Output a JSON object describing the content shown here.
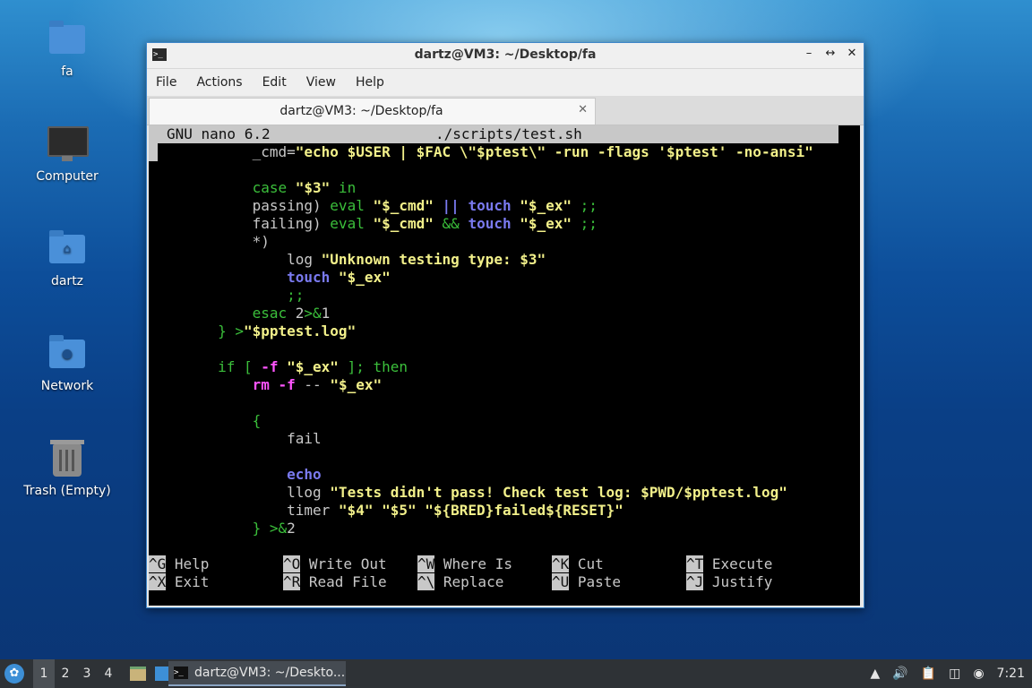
{
  "desktop": {
    "icons": [
      {
        "label": "fa",
        "icon": "folder-icon"
      },
      {
        "label": "Computer",
        "icon": "computer-icon"
      },
      {
        "label": "dartz",
        "icon": "home-folder-icon"
      },
      {
        "label": "Network",
        "icon": "network-folder-icon"
      },
      {
        "label": "Trash (Empty)",
        "icon": "trash-icon"
      }
    ]
  },
  "window": {
    "title": "dartz@VM3: ~/Desktop/fa",
    "controls": {
      "minimize": "–",
      "maximize": "↔",
      "close": "✕"
    },
    "menu": [
      "File",
      "Actions",
      "Edit",
      "View",
      "Help"
    ],
    "tab": {
      "label": "dartz@VM3: ~/Desktop/fa",
      "close": "✕"
    }
  },
  "nano": {
    "header_left": "GNU nano 6.2",
    "header_file": "./scripts/test.sh",
    "shortcuts": [
      {
        "key": "^G",
        "label": "Help"
      },
      {
        "key": "^O",
        "label": "Write Out"
      },
      {
        "key": "^W",
        "label": "Where Is"
      },
      {
        "key": "^K",
        "label": "Cut"
      },
      {
        "key": "^T",
        "label": "Execute"
      },
      {
        "key": "^X",
        "label": "Exit"
      },
      {
        "key": "^R",
        "label": "Read File"
      },
      {
        "key": "^\\",
        "label": "Replace"
      },
      {
        "key": "^U",
        "label": "Paste"
      },
      {
        "key": "^J",
        "label": "Justify"
      }
    ],
    "lines": [
      [
        [
          "def",
          "            _cmd="
        ],
        [
          "str",
          "\"echo $USER | $FAC \\\"$ptest\\\" -run -flags '$ptest' -no-ansi\""
        ]
      ],
      [],
      [
        [
          "def",
          "            "
        ],
        [
          "grn",
          "case "
        ],
        [
          "str",
          "\"$3\""
        ],
        [
          "grn",
          " in"
        ]
      ],
      [
        [
          "def",
          "            passing) "
        ],
        [
          "grn",
          "eval "
        ],
        [
          "str",
          "\"$_cmd\""
        ],
        [
          "blu",
          " || "
        ],
        [
          "blu",
          "touch "
        ],
        [
          "str",
          "\"$_ex\""
        ],
        [
          "grn",
          " ;;"
        ]
      ],
      [
        [
          "def",
          "            failing) "
        ],
        [
          "grn",
          "eval "
        ],
        [
          "str",
          "\"$_cmd\""
        ],
        [
          "grn",
          " && "
        ],
        [
          "blu",
          "touch "
        ],
        [
          "str",
          "\"$_ex\""
        ],
        [
          "grn",
          " ;;"
        ]
      ],
      [
        [
          "def",
          "            *)"
        ]
      ],
      [
        [
          "def",
          "                log "
        ],
        [
          "str",
          "\"Unknown testing type: $3\""
        ]
      ],
      [
        [
          "def",
          "                "
        ],
        [
          "blu",
          "touch "
        ],
        [
          "str",
          "\"$_ex\""
        ]
      ],
      [
        [
          "grn",
          "                ;;"
        ]
      ],
      [
        [
          "grn",
          "            esac "
        ],
        [
          "def",
          "2"
        ],
        [
          "grn",
          ">&"
        ],
        [
          "def",
          "1"
        ]
      ],
      [
        [
          "grn",
          "        } >"
        ],
        [
          "str",
          "\"$pptest.log\""
        ]
      ],
      [],
      [
        [
          "grn",
          "        if [ "
        ],
        [
          "mag",
          "-f "
        ],
        [
          "str",
          "\"$_ex\""
        ],
        [
          "grn",
          " ]; then"
        ]
      ],
      [
        [
          "def",
          "            "
        ],
        [
          "mag",
          "rm "
        ],
        [
          "mag",
          "-f "
        ],
        [
          "def",
          "-- "
        ],
        [
          "str",
          "\"$_ex\""
        ]
      ],
      [],
      [
        [
          "grn",
          "            {"
        ]
      ],
      [
        [
          "def",
          "                fail"
        ]
      ],
      [],
      [
        [
          "def",
          "                "
        ],
        [
          "blu",
          "echo"
        ]
      ],
      [
        [
          "def",
          "                llog "
        ],
        [
          "str",
          "\"Tests didn't pass! Check test log: $PWD/$pptest.log\""
        ]
      ],
      [
        [
          "def",
          "                timer "
        ],
        [
          "str",
          "\"$4\" \"$5\" \"${BRED}failed${RESET}\""
        ]
      ],
      [
        [
          "grn",
          "            } >&"
        ],
        [
          "def",
          "2"
        ]
      ]
    ]
  },
  "taskbar": {
    "workspaces": [
      "1",
      "2",
      "3",
      "4"
    ],
    "active_workspace": "1",
    "app_label": "dartz@VM3: ~/Deskto...",
    "clock": "7:21"
  }
}
